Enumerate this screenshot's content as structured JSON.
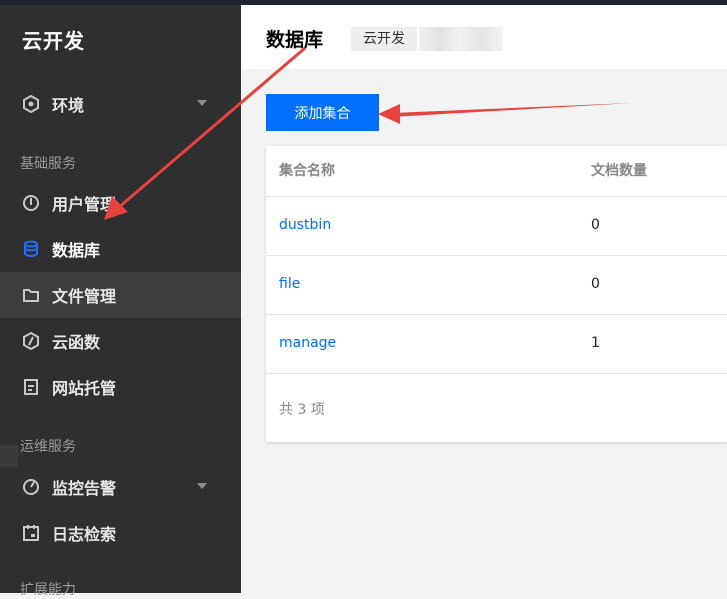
{
  "sidebar": {
    "brand": "云开发",
    "env_item": {
      "label": "环境"
    },
    "section_basic": "基础服务",
    "items_basic": [
      {
        "label": "用户管理",
        "icon": "user-shield-icon"
      },
      {
        "label": "数据库",
        "icon": "database-icon"
      },
      {
        "label": "文件管理",
        "icon": "folder-icon"
      },
      {
        "label": "云函数",
        "icon": "function-icon"
      },
      {
        "label": "网站托管",
        "icon": "web-hosting-icon"
      }
    ],
    "section_ops": "运维服务",
    "items_ops": [
      {
        "label": "监控告警",
        "icon": "monitor-icon"
      },
      {
        "label": "日志检索",
        "icon": "log-calendar-icon"
      }
    ],
    "section_ext": "扩展能力"
  },
  "header": {
    "title": "数据库",
    "env_chip": "云开发"
  },
  "toolbar": {
    "add_label": "添加集合"
  },
  "table": {
    "columns": [
      "集合名称",
      "文档数量"
    ],
    "rows": [
      {
        "name": "dustbin",
        "count": "0"
      },
      {
        "name": "file",
        "count": "0"
      },
      {
        "name": "manage",
        "count": "1"
      }
    ],
    "footer": "共 3 项"
  },
  "colors": {
    "accent": "#006eff",
    "sidebar_bg": "#2f2f2f",
    "annotation_arrow": "#e8423f"
  }
}
